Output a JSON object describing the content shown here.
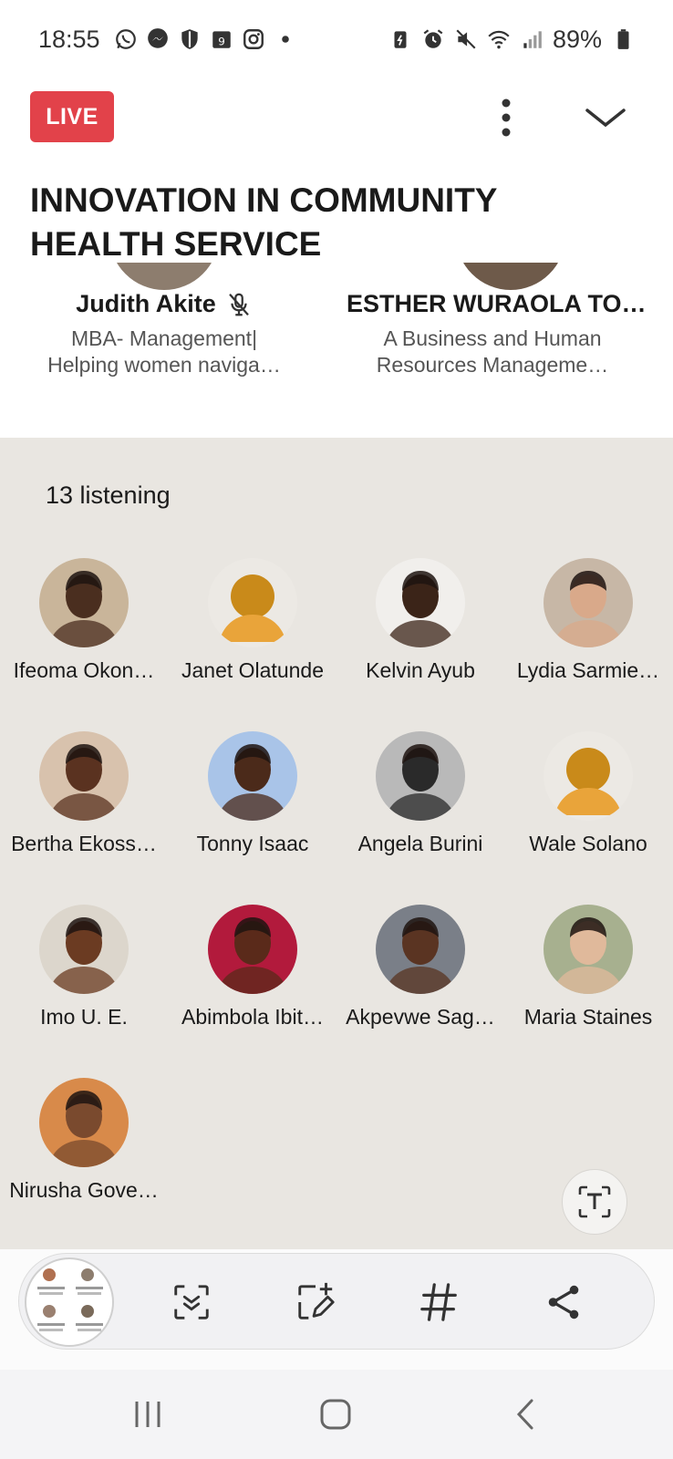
{
  "status_bar": {
    "time": "18:55",
    "battery": "89%",
    "left_icons": [
      "whatsapp-icon",
      "messenger-icon",
      "shield-icon",
      "calendar-icon",
      "instagram-icon",
      "dot-icon"
    ],
    "right_icons": [
      "battery-saver-icon",
      "alarm-icon",
      "mute-icon",
      "wifi-icon",
      "signal-icon",
      "battery-icon"
    ]
  },
  "header": {
    "live_label": "LIVE",
    "title": "INNOVATION IN COMMUNITY HEALTH SERVICE"
  },
  "speakers": [
    {
      "name": "Judith Akite",
      "headline_line1": "MBA- Management|",
      "headline_line2": "Helping women naviga…"
    },
    {
      "name": "ESTHER WURAOLA TO…",
      "headline_line1": "A Business and Human",
      "headline_line2": "Resources Manageme…"
    }
  ],
  "audience": {
    "listening_count": "13 listening",
    "people": [
      {
        "name": "Ifeoma Okon…",
        "avatar": "photo",
        "bg": "#c9b59a",
        "skin": "#4a2e1f"
      },
      {
        "name": "Janet Olatunde",
        "avatar": "default",
        "bg": "#ece9e4",
        "skin": "#c98a1a"
      },
      {
        "name": "Kelvin Ayub",
        "avatar": "photo",
        "bg": "#f1efec",
        "skin": "#3b2418"
      },
      {
        "name": "Lydia Sarmie…",
        "avatar": "photo",
        "bg": "#c7b7a6",
        "skin": "#d9a98a"
      },
      {
        "name": "Bertha Ekoss…",
        "avatar": "photo",
        "bg": "#d8c2ad",
        "skin": "#5a3220"
      },
      {
        "name": "Tonny Isaac",
        "avatar": "photo",
        "bg": "#a9c4e8",
        "skin": "#4b2a1a"
      },
      {
        "name": "Angela Burini",
        "avatar": "photo",
        "bg": "#b9b9b9",
        "skin": "#2a2a2a"
      },
      {
        "name": "Wale Solano",
        "avatar": "default",
        "bg": "#ece9e4",
        "skin": "#c98a1a"
      },
      {
        "name": "Imo U. E.",
        "avatar": "photo",
        "bg": "#dcd6cc",
        "skin": "#6b3b22"
      },
      {
        "name": "Abimbola Ibit…",
        "avatar": "photo",
        "bg": "#b21a3c",
        "skin": "#5a2a1a"
      },
      {
        "name": "Akpevwe Sag…",
        "avatar": "photo",
        "bg": "#7a7f88",
        "skin": "#5a3422"
      },
      {
        "name": "Maria Staines",
        "avatar": "photo",
        "bg": "#a7b08f",
        "skin": "#e0b99b"
      },
      {
        "name": "Nirusha Gove…",
        "avatar": "photo",
        "bg": "#d88a4a",
        "skin": "#7a4a2e"
      }
    ]
  },
  "toolbar": {
    "icons": [
      "scan-text-icon",
      "edit-capture-icon",
      "hashtag-icon",
      "share-icon"
    ]
  },
  "navbar": {
    "icons": [
      "recents-icon",
      "home-icon",
      "back-icon"
    ]
  },
  "colors": {
    "live_red": "#e2424a",
    "audience_bg": "#e9e6e1",
    "default_avatar": "#c98a1a"
  }
}
